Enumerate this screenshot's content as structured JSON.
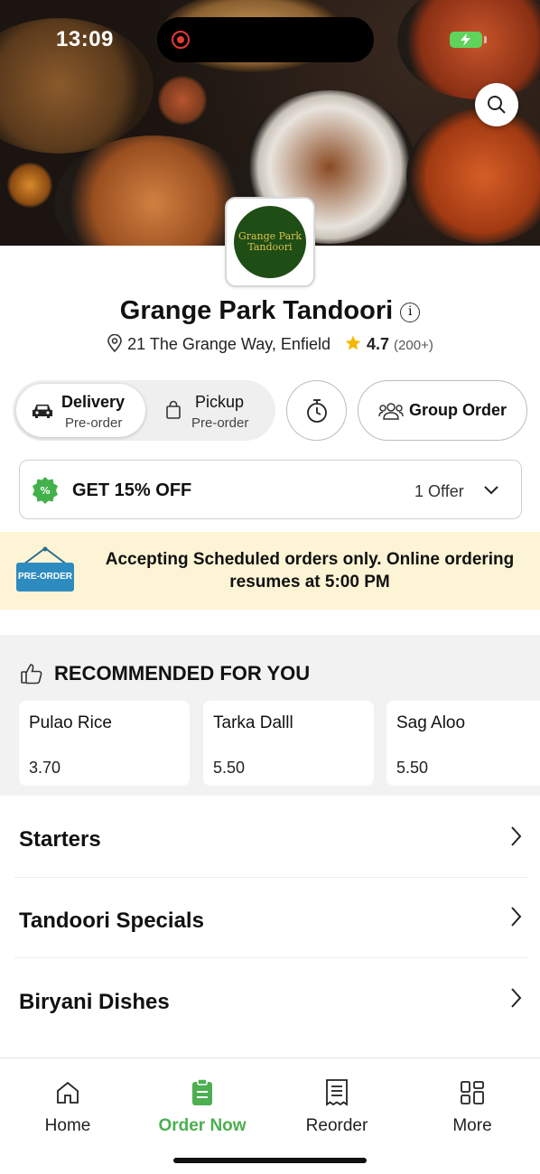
{
  "status_bar": {
    "time": "13:09"
  },
  "restaurant": {
    "logo_text": [
      "Grange Park",
      "Tandoori"
    ],
    "name": "Grange Park Tandoori",
    "address": "21 The Grange Way, Enfield",
    "rating": "4.7",
    "rating_count": "(200+)"
  },
  "order_mode": {
    "delivery_label": "Delivery",
    "delivery_sub": "Pre-order",
    "pickup_label": "Pickup",
    "pickup_sub": "Pre-order",
    "group_order_label": "Group Order",
    "selected": "Delivery"
  },
  "offer": {
    "title": "GET 15% OFF",
    "count": "1 Offer"
  },
  "banner": {
    "sign_text": "PRE-ORDER",
    "message": "Accepting Scheduled orders only. Online ordering resumes at 5:00 PM"
  },
  "recommended": {
    "heading": "RECOMMENDED FOR YOU",
    "items": [
      {
        "name": "Pulao Rice",
        "price": "3.70"
      },
      {
        "name": "Tarka Dalll",
        "price": "5.50"
      },
      {
        "name": "Sag Aloo",
        "price": "5.50"
      }
    ]
  },
  "categories": [
    {
      "label": "Starters"
    },
    {
      "label": "Tandoori Specials"
    },
    {
      "label": "Biryani Dishes"
    }
  ],
  "bottom_nav": {
    "items": [
      {
        "label": "Home",
        "icon": "home-icon"
      },
      {
        "label": "Order Now",
        "icon": "order-icon"
      },
      {
        "label": "Reorder",
        "icon": "receipt-icon"
      },
      {
        "label": "More",
        "icon": "grid-icon"
      }
    ],
    "active": "Order Now"
  },
  "colors": {
    "accent_green": "#4caf50",
    "banner_bg": "#fcf4d4",
    "star": "#f5b800",
    "logo_bg": "#1f4d16"
  }
}
